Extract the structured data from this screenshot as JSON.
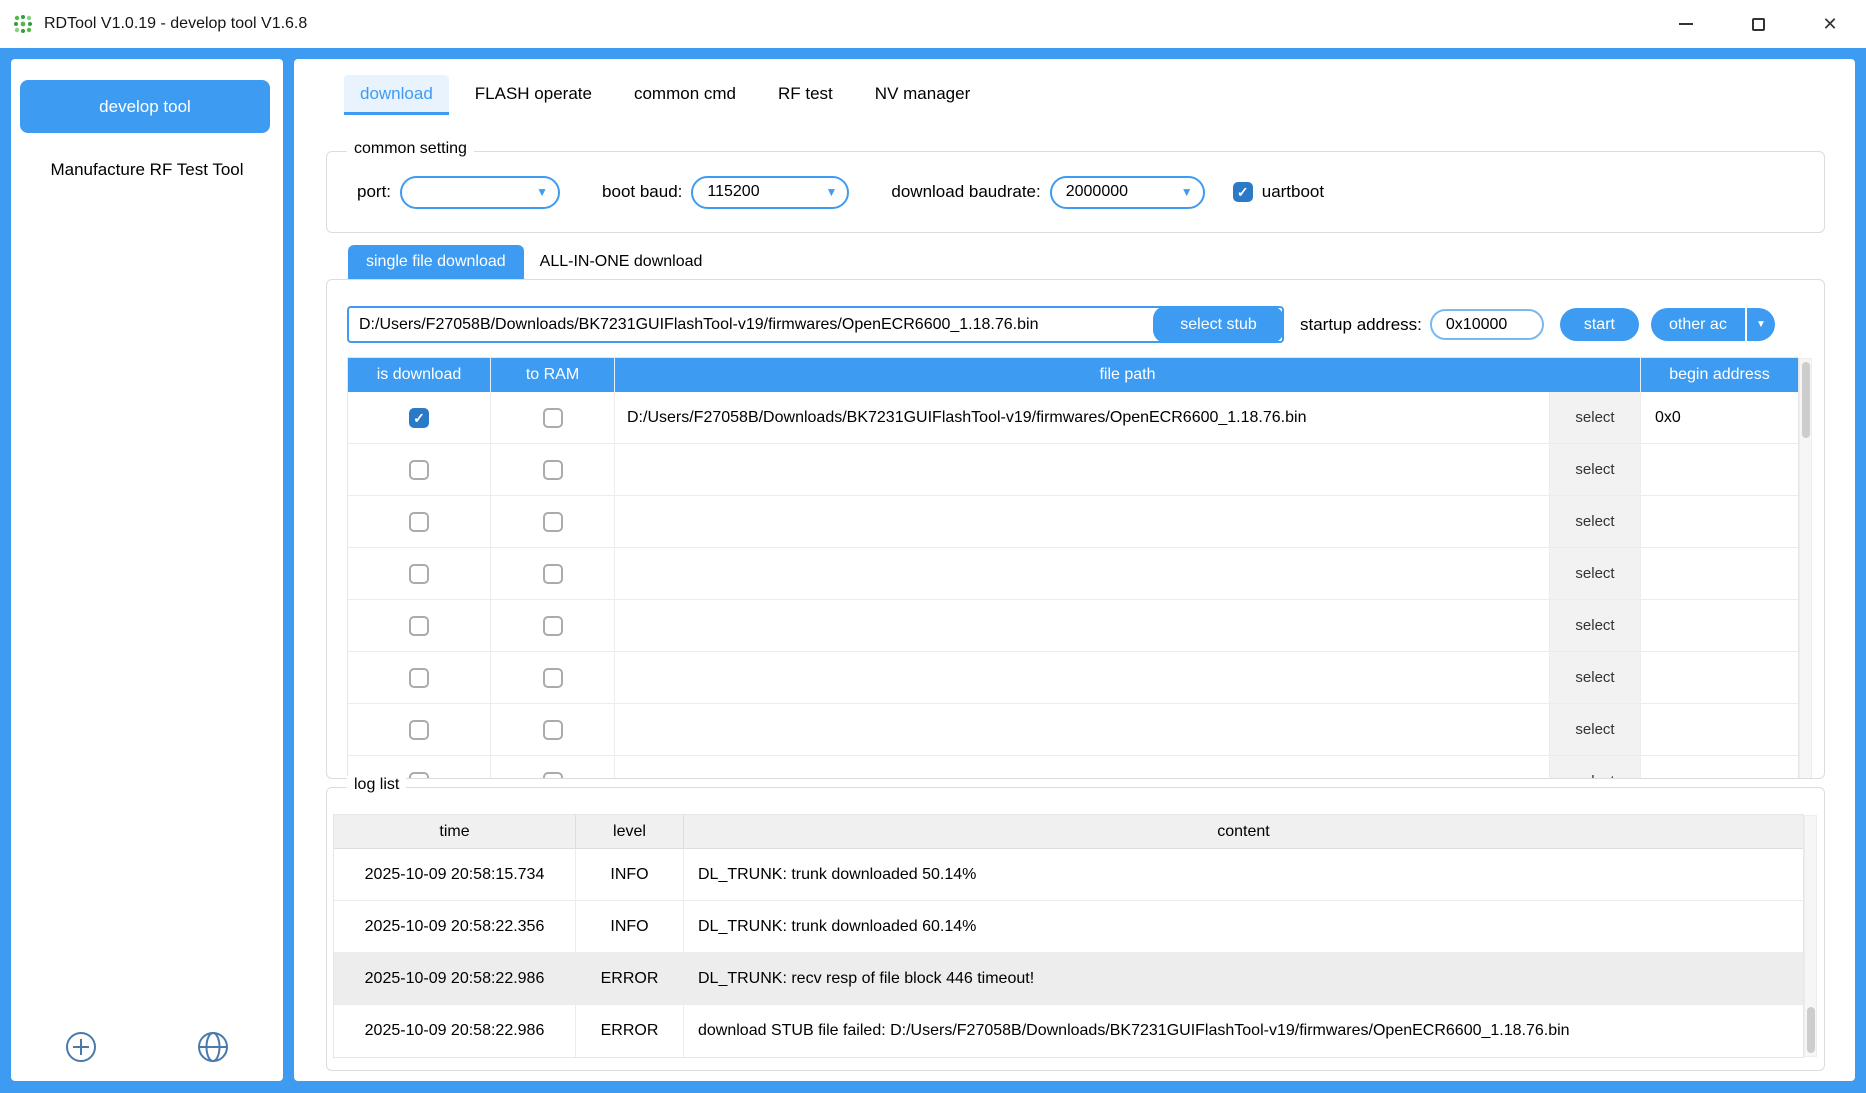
{
  "titlebar": {
    "title": "RDTool V1.0.19 - develop tool V1.6.8"
  },
  "sidebar": {
    "develop_tool": "develop tool",
    "manufacture": "Manufacture RF Test Tool"
  },
  "tabs": [
    {
      "label": "download"
    },
    {
      "label": "FLASH operate"
    },
    {
      "label": "common cmd"
    },
    {
      "label": "RF test"
    },
    {
      "label": "NV manager"
    }
  ],
  "common_setting": {
    "legend": "common setting",
    "port_label": "port:",
    "port_value": "",
    "boot_baud_label": "boot baud:",
    "boot_baud_value": "115200",
    "download_baudrate_label": "download baudrate:",
    "download_baudrate_value": "2000000",
    "uartboot_label": "uartboot",
    "uartboot_checked": true
  },
  "download_tabs": {
    "single": "single file download",
    "all_in_one": "ALL-IN-ONE download"
  },
  "single_file": {
    "file_path": "D:/Users/F27058B/Downloads/BK7231GUIFlashTool-v19/firmwares/OpenECR6600_1.18.76.bin",
    "select_stub": "select stub",
    "startup_address_label": "startup address:",
    "startup_address_value": "0x10000",
    "start": "start",
    "other_action": "other ac"
  },
  "file_table": {
    "headers": {
      "is_download": "is download",
      "to_ram": "to RAM",
      "file_path": "file path",
      "begin_address": "begin address"
    },
    "select_label": "select",
    "rows": [
      {
        "is_download": true,
        "to_ram": false,
        "file_path": "D:/Users/F27058B/Downloads/BK7231GUIFlashTool-v19/firmwares/OpenECR6600_1.18.76.bin",
        "begin_address": "0x0"
      },
      {
        "is_download": false,
        "to_ram": false,
        "file_path": "",
        "begin_address": ""
      },
      {
        "is_download": false,
        "to_ram": false,
        "file_path": "",
        "begin_address": ""
      },
      {
        "is_download": false,
        "to_ram": false,
        "file_path": "",
        "begin_address": ""
      },
      {
        "is_download": false,
        "to_ram": false,
        "file_path": "",
        "begin_address": ""
      },
      {
        "is_download": false,
        "to_ram": false,
        "file_path": "",
        "begin_address": ""
      },
      {
        "is_download": false,
        "to_ram": false,
        "file_path": "",
        "begin_address": ""
      },
      {
        "is_download": false,
        "to_ram": false,
        "file_path": "",
        "begin_address": ""
      }
    ]
  },
  "log": {
    "legend": "log list",
    "headers": {
      "time": "time",
      "level": "level",
      "content": "content"
    },
    "rows": [
      {
        "time": "2025-10-09 20:58:15.734",
        "level": "INFO",
        "content": "DL_TRUNK: trunk downloaded 50.14%"
      },
      {
        "time": "2025-10-09 20:58:22.356",
        "level": "INFO",
        "content": "DL_TRUNK: trunk downloaded 60.14%"
      },
      {
        "time": "2025-10-09 20:58:22.986",
        "level": "ERROR",
        "content": "DL_TRUNK: recv resp of file block 446 timeout!"
      },
      {
        "time": "2025-10-09 20:58:22.986",
        "level": "ERROR",
        "content": "download STUB file failed: D:/Users/F27058B/Downloads/BK7231GUIFlashTool-v19/firmwares/OpenECR6600_1.18.76.bin"
      }
    ]
  },
  "colors": {
    "accent": "#3d9cf2",
    "check": "#2a7ac7"
  }
}
